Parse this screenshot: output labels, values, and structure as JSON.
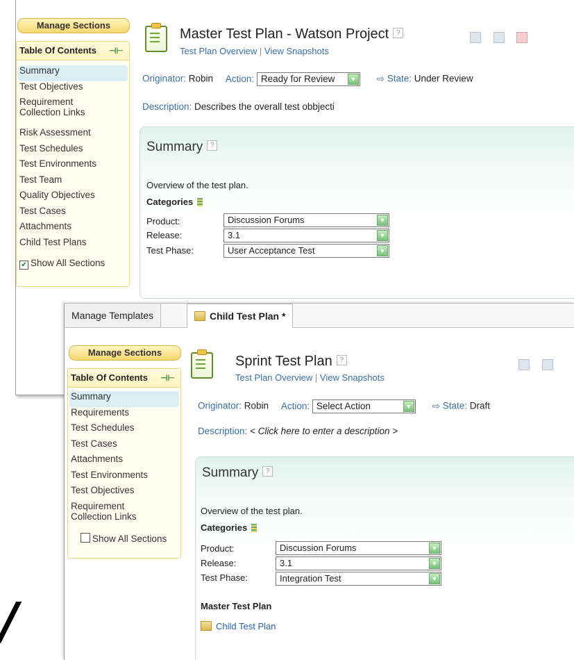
{
  "master": {
    "manage_sections": "Manage Sections",
    "toc_title": "Table Of Contents",
    "toc_items": [
      "Summary",
      "Test Objectives",
      "Requirement Collection Links",
      "Risk Assessment",
      "Test Schedules",
      "Test Environments",
      "Test Team",
      "Quality Objectives",
      "Test Cases",
      "Attachments",
      "Child Test Plans"
    ],
    "show_all": "Show All Sections",
    "show_all_checked": true,
    "title": "Master Test Plan - Watson Project",
    "overview": "Test Plan Overview",
    "snapshots": "View Snapshots",
    "originator_label": "Originator:",
    "originator": "Robin",
    "action_label": "Action:",
    "action_value": "Ready for Review",
    "state_label": "State:",
    "state_value": "Under Review",
    "description_label": "Description:",
    "description": "Describes the overall test obbjecti",
    "summary_title": "Summary",
    "overview_text": "Overview of the test plan.",
    "categories": "Categories",
    "product_label": "Product:",
    "product": "Discussion Forums",
    "release_label": "Release:",
    "release": "3.1",
    "phase_label": "Test Phase:",
    "phase": "User Acceptance Test"
  },
  "child": {
    "tab_templates": "Manage Templates",
    "tab_child": "Child Test Plan *",
    "manage_sections": "Manage Sections",
    "toc_title": "Table Of Contents",
    "toc_items": [
      "Summary",
      "Requirements",
      "Test Schedules",
      "Test Cases",
      "Attachments",
      "Test Environments",
      "Test Objectives",
      "Requirement Collection Links"
    ],
    "show_all": "Show All Sections",
    "show_all_checked": false,
    "title": "Sprint Test Plan",
    "overview": "Test Plan Overview",
    "snapshots": "View Snapshots",
    "originator_label": "Originator:",
    "originator": "Robin",
    "action_label": "Action:",
    "action_value": "Select Action",
    "state_label": "State:",
    "state_value": "Draft",
    "description_label": "Description:",
    "description": "< Click here to enter a description >",
    "summary_title": "Summary",
    "overview_text": "Overview of the test plan.",
    "categories": "Categories",
    "product_label": "Product:",
    "product": "Discussion Forums",
    "release_label": "Release:",
    "release": "3.1",
    "phase_label": "Test Phase:",
    "phase": "Integration Test",
    "master_heading": "Master Test Plan",
    "master_link": "Child Test Plan"
  },
  "icons": {
    "help": "help-icon",
    "pin": "pin-icon",
    "state_arrow": "⇨"
  },
  "colors": {
    "link": "#3a6fa0",
    "summary_bg": "#dff2eb",
    "toc_bg": "#fffef0",
    "dropdown_arrow": "#78c277"
  }
}
